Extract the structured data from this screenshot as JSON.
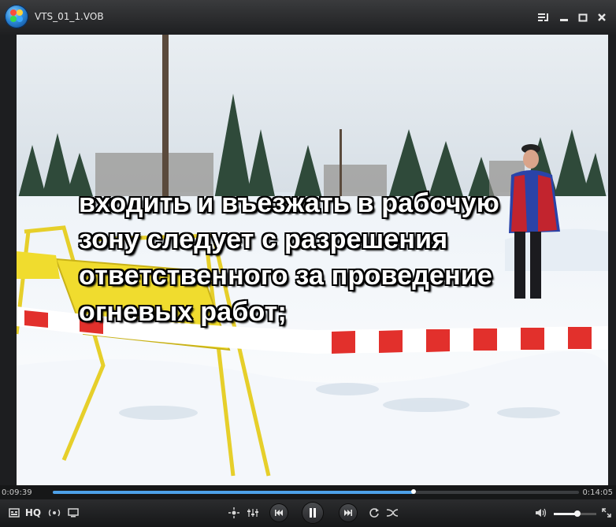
{
  "window": {
    "title": "VTS_01_1.VOB"
  },
  "video": {
    "subtitle_lines": [
      "входить и въезжать в рабочую",
      "зону следует с разрешения",
      "ответственного за проведение",
      "огневых работ;"
    ]
  },
  "seek": {
    "elapsed": "0:09:39",
    "total": "0:14:05",
    "progress_fraction": 0.685
  },
  "controls": {
    "hq_label": "HQ",
    "volume_fraction": 0.55
  },
  "icons": {
    "playlist": "playlist-icon",
    "minimize": "minimize-icon",
    "maximize": "maximize-icon",
    "close": "close-icon",
    "settings": "settings-icon",
    "broadcast": "broadcast-icon",
    "screen": "screen-icon",
    "capture": "capture-icon",
    "equalizer": "equalizer-icon",
    "prev": "previous-icon",
    "pause": "pause-icon",
    "next": "next-icon",
    "repeat": "repeat-icon",
    "shuffle": "shuffle-icon",
    "volume": "volume-icon",
    "fullscreen": "fullscreen-icon"
  },
  "colors": {
    "accent": "#4da0e8",
    "background": "#1d1e20"
  }
}
